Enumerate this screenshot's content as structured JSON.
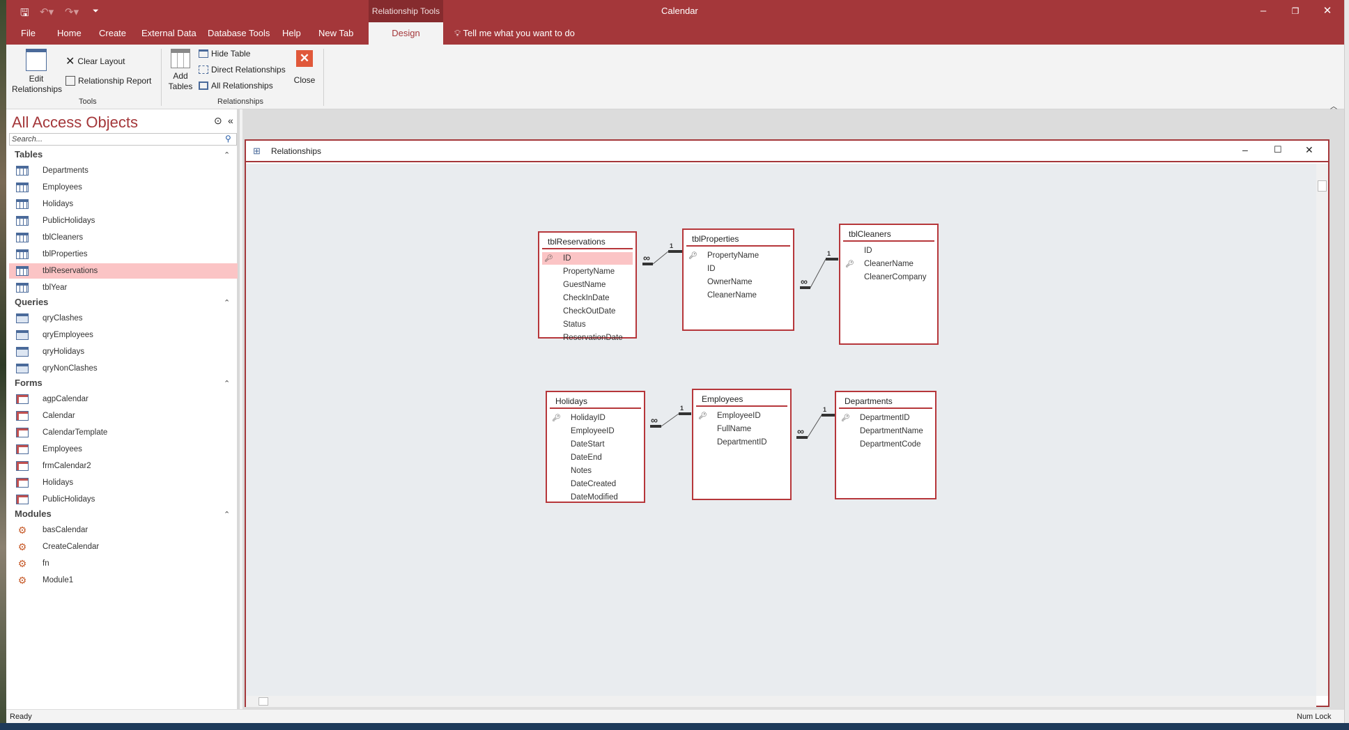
{
  "app": {
    "title": "Calendar",
    "context_tab": "Relationship Tools"
  },
  "menu": {
    "tabs": [
      "File",
      "Home",
      "Create",
      "External Data",
      "Database Tools",
      "Help",
      "New Tab"
    ],
    "active_tab": "Design",
    "tell_me": "Tell me what you want to do"
  },
  "ribbon": {
    "edit_relationships": "Edit Relationships",
    "clear_layout": "Clear Layout",
    "relationship_report": "Relationship Report",
    "tools_group": "Tools",
    "add_tables": "Add Tables",
    "hide_table": "Hide Table",
    "direct_relationships": "Direct Relationships",
    "all_relationships": "All Relationships",
    "close": "Close",
    "relationships_group": "Relationships"
  },
  "nav": {
    "title": "All Access Objects",
    "search_placeholder": "Search...",
    "sections": [
      {
        "name": "Tables",
        "type": "table",
        "items": [
          "Departments",
          "Employees",
          "Holidays",
          "PublicHolidays",
          "tblCleaners",
          "tblProperties",
          "tblReservations",
          "tblYear"
        ],
        "selected": "tblReservations"
      },
      {
        "name": "Queries",
        "type": "query",
        "items": [
          "qryClashes",
          "qryEmployees",
          "qryHolidays",
          "qryNonClashes"
        ]
      },
      {
        "name": "Forms",
        "type": "form",
        "items": [
          "agpCalendar",
          "Calendar",
          "CalendarTemplate",
          "Employees",
          "frmCalendar2",
          "Holidays",
          "PublicHolidays"
        ]
      },
      {
        "name": "Modules",
        "type": "module",
        "items": [
          "basCalendar",
          "CreateCalendar",
          "fn",
          "Module1"
        ]
      }
    ]
  },
  "relationships_window": {
    "title": "Relationships",
    "tables": [
      {
        "name": "tblReservations",
        "fields": [
          "ID",
          "PropertyName",
          "GuestName",
          "CheckInDate",
          "CheckOutDate",
          "Status",
          "ReservationDate"
        ],
        "keys": [
          "ID"
        ],
        "selected_field": "ID"
      },
      {
        "name": "tblProperties",
        "fields": [
          "PropertyName",
          "ID",
          "OwnerName",
          "CleanerName"
        ],
        "keys": [
          "PropertyName"
        ]
      },
      {
        "name": "tblCleaners",
        "fields": [
          "ID",
          "CleanerName",
          "CleanerCompany"
        ],
        "keys": [
          "CleanerName"
        ]
      },
      {
        "name": "Holidays",
        "fields": [
          "HolidayID",
          "EmployeeID",
          "DateStart",
          "DateEnd",
          "Notes",
          "DateCreated",
          "DateModified"
        ],
        "keys": [
          "HolidayID"
        ]
      },
      {
        "name": "Employees",
        "fields": [
          "EmployeeID",
          "FullName",
          "DepartmentID"
        ],
        "keys": [
          "EmployeeID"
        ]
      },
      {
        "name": "Departments",
        "fields": [
          "DepartmentID",
          "DepartmentName",
          "DepartmentCode"
        ],
        "keys": [
          "DepartmentID"
        ]
      }
    ],
    "relations": [
      {
        "from": "tblReservations.PropertyName",
        "to": "tblProperties.PropertyName",
        "many_label": "∞",
        "one_label": "1"
      },
      {
        "from": "tblProperties.CleanerName",
        "to": "tblCleaners.CleanerName",
        "many_label": "∞",
        "one_label": "1"
      },
      {
        "from": "Holidays.EmployeeID",
        "to": "Employees.EmployeeID",
        "many_label": "∞",
        "one_label": "1"
      },
      {
        "from": "Employees.DepartmentID",
        "to": "Departments.DepartmentID",
        "many_label": "∞",
        "one_label": "1"
      }
    ]
  },
  "status": {
    "left": "Ready",
    "right": "Num Lock"
  },
  "colors": {
    "accent": "#a4373a",
    "selection": "#fbc4c5"
  }
}
